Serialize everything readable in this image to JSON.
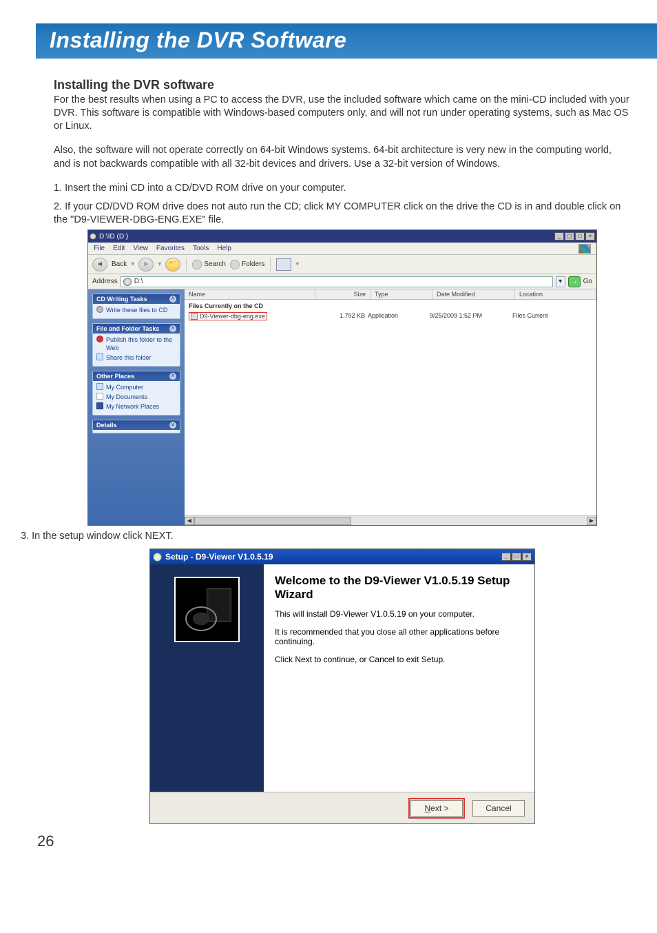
{
  "page_number": "26",
  "banner_title": "Installing the DVR Software",
  "section_heading": "Installing the DVR software",
  "paragraphs": {
    "p1": "For the best results when using a PC to access the DVR, use the included software which came on the mini-CD included with your DVR. This software is compatible with Windows-based computers only, and will not run under operating systems, such as Mac OS or Linux.",
    "p2": "Also, the software will not operate correctly on 64-bit Windows systems. 64-bit architecture is very new in the computing world, and is not backwards compatible with all 32-bit devices and drivers. Use a 32-bit version of Windows.",
    "step1": "1. Insert the mini CD into a CD/DVD ROM drive on your computer.",
    "step2": "2. If your CD/DVD ROM drive does not auto run the CD; click MY COMPUTER click on the drive the CD is in and double click on the \"D9-VIEWER-DBG-ENG.EXE\" file.",
    "step3": "3. In the setup window click NEXT."
  },
  "explorer": {
    "title": "D:\\ID (D:)",
    "menus": {
      "file": "File",
      "edit": "Edit",
      "view": "View",
      "favorites": "Favorites",
      "tools": "Tools",
      "help": "Help"
    },
    "toolbar": {
      "back": "Back",
      "search": "Search",
      "folders": "Folders"
    },
    "address_label": "Address",
    "address_value": "D:\\",
    "go_label": "Go",
    "columns": {
      "name": "Name",
      "size": "Size",
      "type": "Type",
      "modified": "Date Modified",
      "location": "Location"
    },
    "group_label": "Files Currently on the CD",
    "file": {
      "name": "D9-Viewer-dbg-eng.exe",
      "size": "1,792 KB",
      "type": "Application",
      "modified": "9/25/2009 1:52 PM",
      "location": "Files Current"
    },
    "side": {
      "cd_writing": {
        "title": "CD Writing Tasks",
        "write": "Write these files to CD"
      },
      "file_folder": {
        "title": "File and Folder Tasks",
        "publish": "Publish this folder to the Web",
        "share": "Share this folder"
      },
      "other_places": {
        "title": "Other Places",
        "mycomputer": "My Computer",
        "mydocs": "My Documents",
        "mynet": "My Network Places"
      },
      "details": {
        "title": "Details"
      }
    }
  },
  "wizard": {
    "window_title": "Setup - D9-Viewer V1.0.5.19",
    "heading": "Welcome to the D9-Viewer V1.0.5.19 Setup Wizard",
    "line1": "This will install D9-Viewer V1.0.5.19 on your computer.",
    "line2": "It is recommended that you close all other applications before continuing.",
    "line3": "Click Next to continue, or Cancel to exit Setup.",
    "next_underline": "N",
    "next_rest": "ext >",
    "cancel": "Cancel"
  }
}
